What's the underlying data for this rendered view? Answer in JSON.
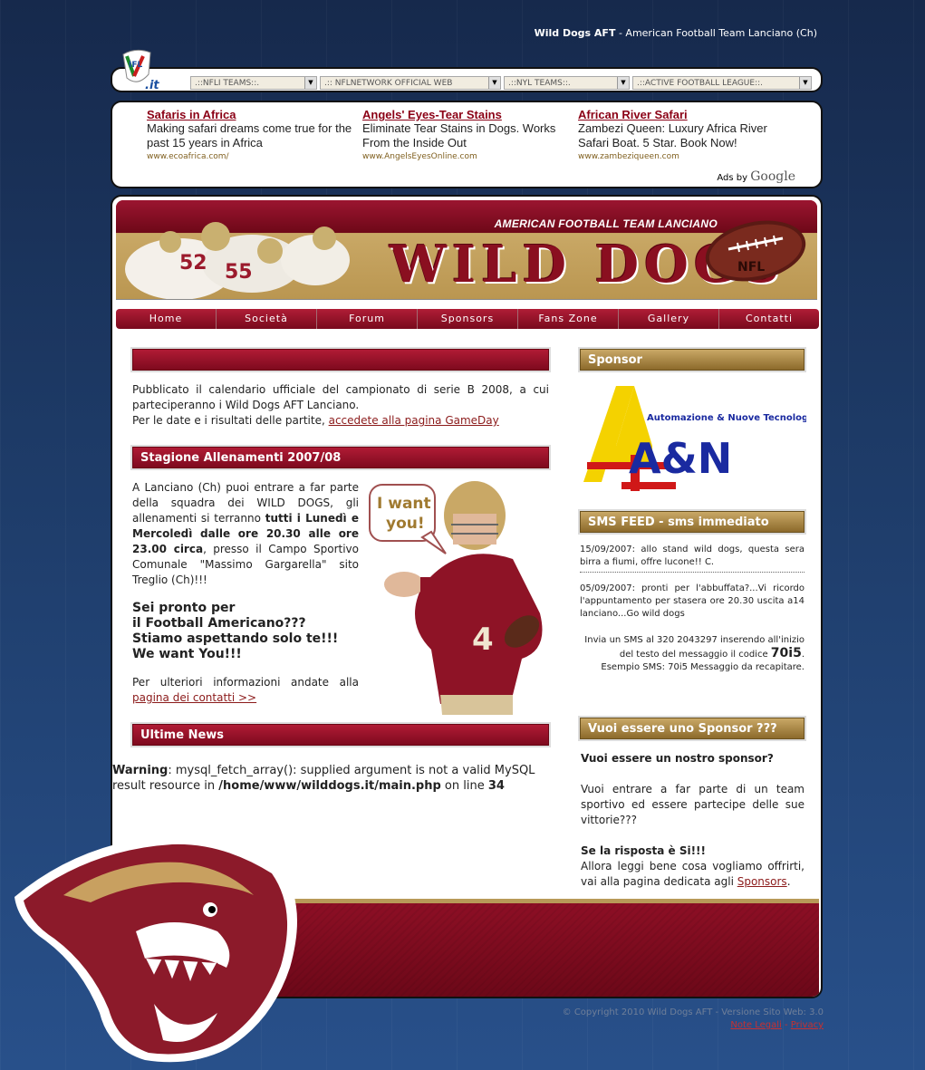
{
  "top": {
    "brand": "Wild Dogs AFT",
    "tagline": " - American Football Team Lanciano (Ch)"
  },
  "nav": {
    "logo_text": ".it",
    "logo_letters": "IFL",
    "selects": [
      ".::NFLI TEAMS::.",
      ".:: NFLNETWORK OFFICIAL WEB",
      ".::NYL TEAMS::.",
      ".::ACTIVE FOOTBALL LEAGUE::."
    ]
  },
  "ads": {
    "items": [
      {
        "title": "Safaris in Africa",
        "desc": "Making safari dreams come true for the past 15 years in Africa",
        "url": "www.ecoafrica.com/"
      },
      {
        "title": "Angels' Eyes-Tear Stains",
        "desc": "Eliminate Tear Stains in Dogs. Works From the Inside Out",
        "url": "www.AngelsEyesOnline.com"
      },
      {
        "title": "African River Safari",
        "desc": "Zambezi Queen: Luxury Africa River Safari Boat. 5 Star. Book Now!",
        "url": "www.zambeziqueen.com"
      }
    ],
    "ads_by": "Ads by",
    "google": "Google"
  },
  "header": {
    "subtitle": "AMERICAN FOOTBALL TEAM LANCIANO",
    "title": "WILD DOGS"
  },
  "menu": [
    "Home",
    "Società",
    "Forum",
    "Sponsors",
    "Fans Zone",
    "Gallery",
    "Contatti"
  ],
  "news": {
    "p1": "Pubblicato il calendario ufficiale del campionato di serie B 2008, a cui parteciperanno i Wild Dogs AFT Lanciano.",
    "p2": "Per le date e i risultati delle partite, ",
    "p2_link": "accedete alla pagina GameDay"
  },
  "training": {
    "heading": "Stagione Allenamenti 2007/08",
    "p1a": "A Lanciano (Ch) puoi entrare a far parte della squadra dei WILD DOGS, gli allenamenti si terranno ",
    "p1b": "tutti i Lunedì e Mercoledì dalle ore 20.30 alle ore 23.00 circa",
    "p1c": ", presso il Campo Sportivo Comunale \"Massimo Gargarella\" sito Treglio (Ch)!!!",
    "slogan1": "Sei pronto per",
    "slogan2": "il Football Americano???",
    "slogan3": "Stiamo aspettando solo te!!!",
    "slogan4": "We want You!!!",
    "p2": "Per ulteriori informazioni andate alla ",
    "p2_link": "pagina dei contatti >>",
    "bubble": "I want you!"
  },
  "latest": {
    "heading": "Ultime News",
    "warning_label": "Warning",
    "warning_text": ": mysql_fetch_array(): supplied argument is not a valid MySQL result resource in ",
    "warning_path": "/home/www/wilddogs.it/main.php",
    "warning_mid": " on line ",
    "warning_line": "34"
  },
  "sidebar": {
    "sponsor_heading": "Sponsor",
    "sponsor_logo_text": "Automazione & Nuove Tecnologie srl",
    "sponsor_logo_letters": "A&N",
    "sms_heading": "SMS FEED - sms immediato",
    "sms": [
      "15/09/2007: allo stand wild dogs, questa sera birra a fiumi, offre lucone!! C.",
      "05/09/2007: pronti per l'abbuffata?...Vi ricordo l'appuntamento per stasera ore 20.30 uscita a14 lanciano...Go wild dogs"
    ],
    "sms_info1": "Invia un SMS al 320 2043297 inserendo all'inizio",
    "sms_info2": "del testo del messaggio il codice ",
    "sms_code": "70i5",
    "sms_info3": "Esempio SMS: 70i5 Messaggio da recapitare.",
    "become_heading": "Vuoi essere uno Sponsor ???",
    "become_q": "Vuoi essere un nostro sponsor?",
    "become_p1": "Vuoi entrare a far parte di un team sportivo ed essere partecipe delle sue vittorie???",
    "become_yes": "Se la risposta è Si!!!",
    "become_p2": "Allora leggi bene cosa vogliamo offrirti, vai alla pagina dedicata agli ",
    "become_link": "Sponsors"
  },
  "footer": {
    "copyright": "© Copyright 2010 Wild Dogs AFT - Versione Sito Web: 3.0",
    "legal": "Note Legali",
    "sep": " - ",
    "privacy": "Privacy"
  },
  "colors": {
    "maroon": "#8b0f22",
    "gold": "#b89a58",
    "bg": "#1d3a66"
  }
}
